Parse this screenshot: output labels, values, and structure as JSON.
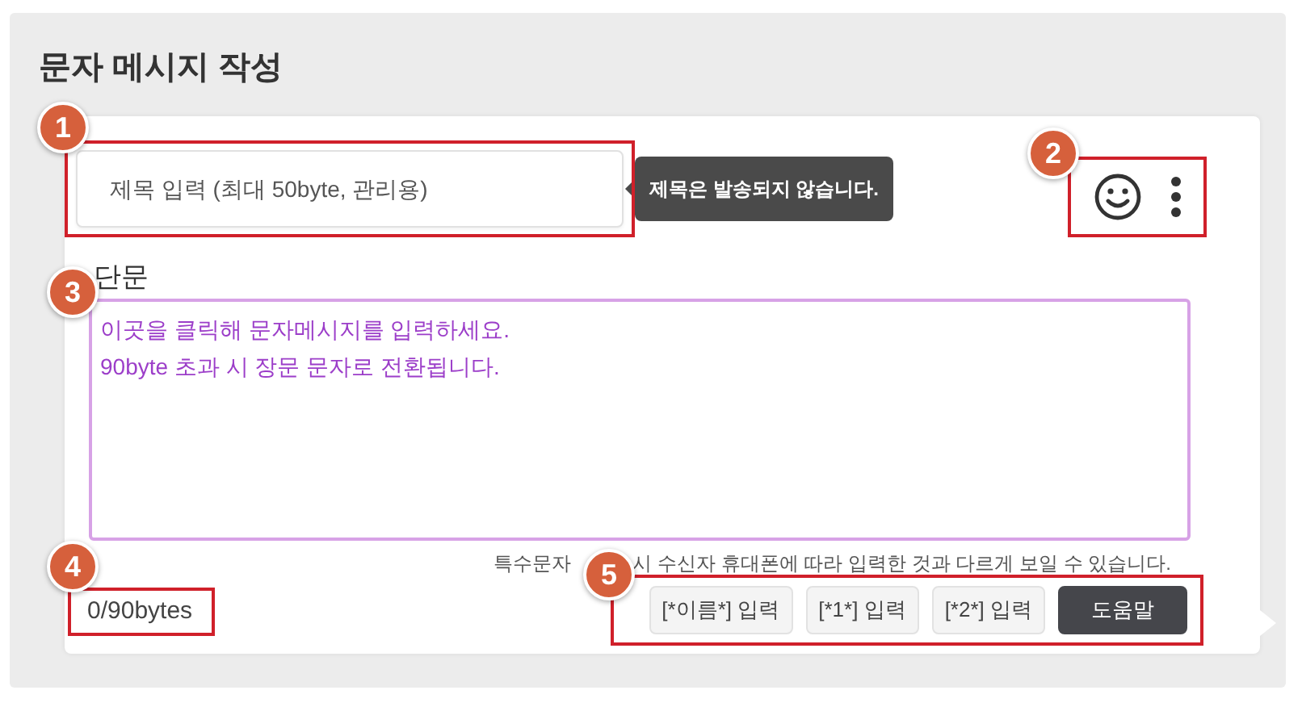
{
  "title": "문자 메시지 작성",
  "subject": {
    "placeholder": "제목 입력 (최대 50byte, 관리용)",
    "tooltip": "제목은 발송되지 않습니다.",
    "callout": "1"
  },
  "toolbar": {
    "callout": "2"
  },
  "message": {
    "label": "단문",
    "placeholder": "이곳을 클릭해 문자메시지를 입력하세요.\n90byte 초과 시 장문 문자로 전환됩니다.",
    "callout": "3"
  },
  "notice": [
    "특수문자",
    "시 수신자 휴대폰에 따라 입력한 것과 다르게 보일 수 있습니다."
  ],
  "byte_count": {
    "text": "0/90bytes",
    "callout": "4"
  },
  "buttons": {
    "callout": "5",
    "items": [
      {
        "label": "[*이름*] 입력",
        "kind": "insert"
      },
      {
        "label": "[*1*] 입력",
        "kind": "insert"
      },
      {
        "label": "[*2*] 입력",
        "kind": "insert"
      },
      {
        "label": "도움말",
        "kind": "help"
      }
    ]
  }
}
